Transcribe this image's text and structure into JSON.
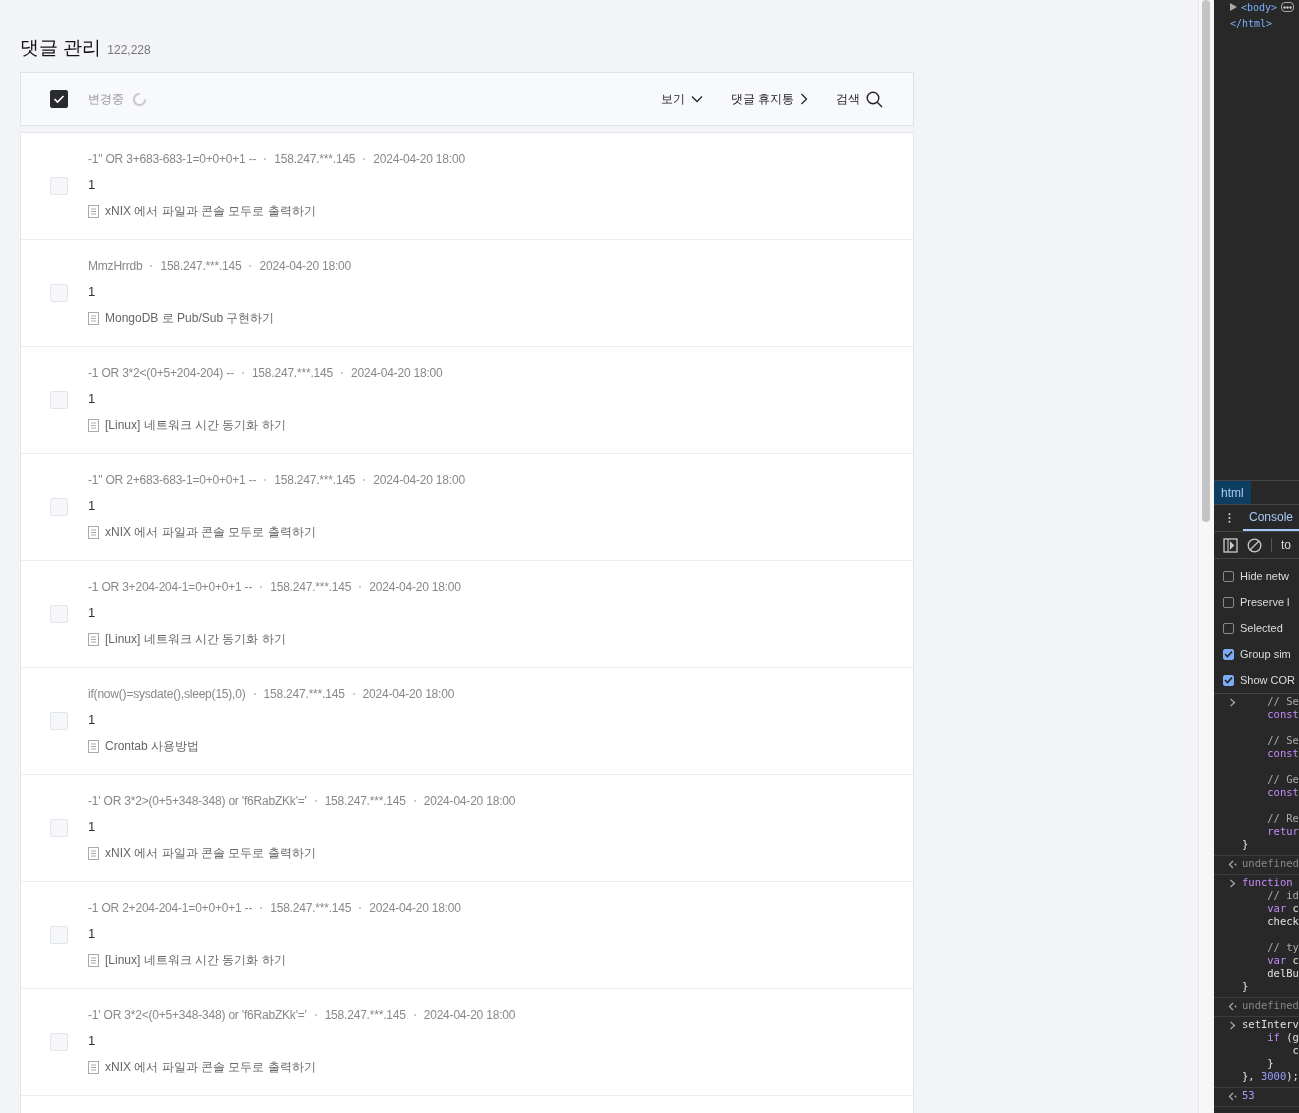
{
  "page": {
    "title": "댓글 관리",
    "count": "122,228"
  },
  "toolbar": {
    "select_all_checked": true,
    "status": "변경중",
    "view": "보기",
    "trash": "댓글 휴지통",
    "search": "검색"
  },
  "comments": [
    {
      "author": "-1\" OR 3+683-683-1=0+0+0+1 --",
      "ip": "158.247.***.145",
      "date": "2024-04-20 18:00",
      "body": "1",
      "post": "xNIX 에서 파일과 콘솔 모두로 출력하기",
      "checked": false
    },
    {
      "author": "MmzHrrdb",
      "ip": "158.247.***.145",
      "date": "2024-04-20 18:00",
      "body": "1",
      "post": "MongoDB 로 Pub/Sub 구현하기",
      "checked": false
    },
    {
      "author": "-1 OR 3*2<(0+5+204-204) --",
      "ip": "158.247.***.145",
      "date": "2024-04-20 18:00",
      "body": "1",
      "post": "[Linux] 네트워크 시간 동기화 하기",
      "checked": false
    },
    {
      "author": "-1\" OR 2+683-683-1=0+0+0+1 --",
      "ip": "158.247.***.145",
      "date": "2024-04-20 18:00",
      "body": "1",
      "post": "xNIX 에서 파일과 콘솔 모두로 출력하기",
      "checked": false
    },
    {
      "author": "-1 OR 3+204-204-1=0+0+0+1 --",
      "ip": "158.247.***.145",
      "date": "2024-04-20 18:00",
      "body": "1",
      "post": "[Linux] 네트워크 시간 동기화 하기",
      "checked": false
    },
    {
      "author": "if(now()=sysdate(),sleep(15),0)",
      "ip": "158.247.***.145",
      "date": "2024-04-20 18:00",
      "body": "1",
      "post": "Crontab 사용방법",
      "checked": false
    },
    {
      "author": "-1' OR 3*2>(0+5+348-348) or 'f6RabZKk'='",
      "ip": "158.247.***.145",
      "date": "2024-04-20 18:00",
      "body": "1",
      "post": "xNIX 에서 파일과 콘솔 모두로 출력하기",
      "checked": false
    },
    {
      "author": "-1 OR 2+204-204-1=0+0+0+1 --",
      "ip": "158.247.***.145",
      "date": "2024-04-20 18:00",
      "body": "1",
      "post": "[Linux] 네트워크 시간 동기화 하기",
      "checked": false
    },
    {
      "author": "-1' OR 3*2<(0+5+348-348) or 'f6RabZKk'='",
      "ip": "158.247.***.145",
      "date": "2024-04-20 18:00",
      "body": "1",
      "post": "xNIX 에서 파일과 콘솔 모두로 출력하기",
      "checked": false
    }
  ],
  "devtools": {
    "elements": [
      "<body>",
      "</html>"
    ],
    "breadcrumb": "html",
    "tabs": [
      {
        "label": "Console",
        "selected": true
      }
    ],
    "filter": "to",
    "settings": [
      {
        "label": "Hide netw",
        "checked": false
      },
      {
        "label": "Preserve l",
        "checked": false
      },
      {
        "label": "Selected",
        "checked": false
      },
      {
        "label": "Group sim",
        "checked": true
      },
      {
        "label": "Show COR",
        "checked": true
      }
    ],
    "console": [
      {
        "kind": "input",
        "blocks": [
          [
            [
              {
                "text": "    // Se",
                "kind": "comment"
              }
            ],
            [
              {
                "text": "    const",
                "kind": "keyword"
              }
            ]
          ],
          [
            [
              {
                "text": "    // Se",
                "kind": "comment"
              }
            ],
            [
              {
                "text": "    const",
                "kind": "keyword"
              }
            ]
          ],
          [
            [
              {
                "text": "    // Ge",
                "kind": "comment"
              }
            ],
            [
              {
                "text": "    const",
                "kind": "keyword"
              }
            ]
          ],
          [
            [
              {
                "text": "    // Re",
                "kind": "comment"
              }
            ],
            [
              {
                "text": "    retur",
                "kind": "keyword"
              }
            ],
            [
              {
                "text": "}",
                "kind": "plain"
              }
            ]
          ]
        ]
      },
      {
        "kind": "output",
        "blocks": [
          [
            [
              {
                "text": "undefined",
                "kind": "muted"
              }
            ]
          ]
        ]
      },
      {
        "kind": "input",
        "blocks": [
          [
            [
              {
                "text": "function",
                "kind": "keyword"
              }
            ],
            [
              {
                "text": "    // id",
                "kind": "comment"
              }
            ],
            [
              {
                "text": "    var",
                "kind": "keyword"
              },
              {
                "text": " c",
                "kind": "plain"
              }
            ],
            [
              {
                "text": "    check",
                "kind": "plain"
              }
            ]
          ],
          [
            [
              {
                "text": "    // ty",
                "kind": "comment"
              }
            ],
            [
              {
                "text": "    var",
                "kind": "keyword"
              },
              {
                "text": " c",
                "kind": "plain"
              }
            ],
            [
              {
                "text": "    delBu",
                "kind": "plain"
              }
            ],
            [
              {
                "text": "}",
                "kind": "plain"
              }
            ]
          ]
        ]
      },
      {
        "kind": "output",
        "blocks": [
          [
            [
              {
                "text": "undefined",
                "kind": "muted"
              }
            ]
          ]
        ]
      },
      {
        "kind": "input",
        "blocks": [
          [
            [
              {
                "text": "setInterv",
                "kind": "plain"
              }
            ],
            [
              {
                "text": "    if",
                "kind": "keyword"
              },
              {
                "text": " (g",
                "kind": "plain"
              }
            ],
            [
              {
                "text": "        c",
                "kind": "plain"
              }
            ],
            [
              {
                "text": "    }",
                "kind": "plain"
              }
            ],
            [
              {
                "text": "}, ",
                "kind": "plain"
              },
              {
                "text": "3000",
                "kind": "number"
              },
              {
                "text": ");",
                "kind": "plain"
              }
            ]
          ]
        ]
      },
      {
        "kind": "output",
        "blocks": [
          [
            [
              {
                "text": "53",
                "kind": "number"
              }
            ]
          ]
        ]
      }
    ]
  }
}
